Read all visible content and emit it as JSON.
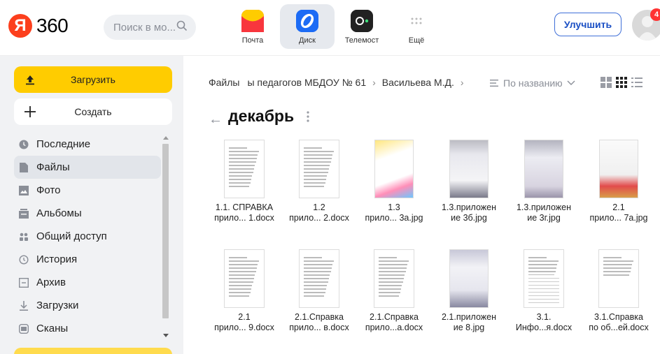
{
  "header": {
    "logo_letter": "Я",
    "logo_text": "360",
    "search_placeholder": "Поиск в мо...",
    "services": [
      {
        "label": "Почта",
        "icon": "mail-icon",
        "color": "#f8363d"
      },
      {
        "label": "Диск",
        "icon": "disk-icon",
        "color": "#1c6bf5",
        "active": true
      },
      {
        "label": "Телемост",
        "icon": "telemost-icon",
        "color": "#222222"
      },
      {
        "label": "Ещё",
        "icon": "more-dots-icon"
      }
    ],
    "upgrade_label": "Улучшить",
    "notification_count": "4"
  },
  "sidebar": {
    "upload_label": "Загрузить",
    "create_label": "Создать",
    "items": [
      {
        "label": "Последние",
        "icon": "clock-icon"
      },
      {
        "label": "Файлы",
        "icon": "file-icon",
        "active": true
      },
      {
        "label": "Фото",
        "icon": "photo-icon"
      },
      {
        "label": "Альбомы",
        "icon": "albums-icon"
      },
      {
        "label": "Общий доступ",
        "icon": "shared-icon"
      },
      {
        "label": "История",
        "icon": "history-icon"
      },
      {
        "label": "Архив",
        "icon": "archive-icon"
      },
      {
        "label": "Загрузки",
        "icon": "downloads-icon"
      },
      {
        "label": "Сканы",
        "icon": "scans-icon"
      }
    ]
  },
  "main": {
    "breadcrumb": [
      "Файлы",
      "ы педагогов МБДОУ № 61",
      "Васильева М.Д."
    ],
    "sort_label": "По названию",
    "folder_title": "декабрь",
    "files": [
      {
        "line1": "1.1. СПРАВКА",
        "line2": "прило... 1.docx",
        "kind": "doc"
      },
      {
        "line1": "1.2",
        "line2": "прило... 2.docx",
        "kind": "doc"
      },
      {
        "line1": "1.3",
        "line2": "прило... 3a.jpg",
        "kind": "img-diploma"
      },
      {
        "line1": "1.3.приложен",
        "line2": "ие 3б.jpg",
        "kind": "img-cert"
      },
      {
        "line1": "1.3.приложен",
        "line2": "ие 3г.jpg",
        "kind": "img-cert2"
      },
      {
        "line1": "2.1",
        "line2": "прило... 7a.jpg",
        "kind": "img-letter"
      },
      {
        "line1": "2.1",
        "line2": "прило... 9.docx",
        "kind": "doc"
      },
      {
        "line1": "2.1.Справка",
        "line2": "прило... в.docx",
        "kind": "doc"
      },
      {
        "line1": "2.1.Справка",
        "line2": "прило...а.docx",
        "kind": "doc"
      },
      {
        "line1": "2.1.приложен",
        "line2": "ие 8.jpg",
        "kind": "img-diploma2"
      },
      {
        "line1": "3.1.",
        "line2": "Инфо...я.docx",
        "kind": "doc-table"
      },
      {
        "line1": "3.1.Справка",
        "line2": "по об...ей.docx",
        "kind": "doc-table2"
      }
    ]
  }
}
